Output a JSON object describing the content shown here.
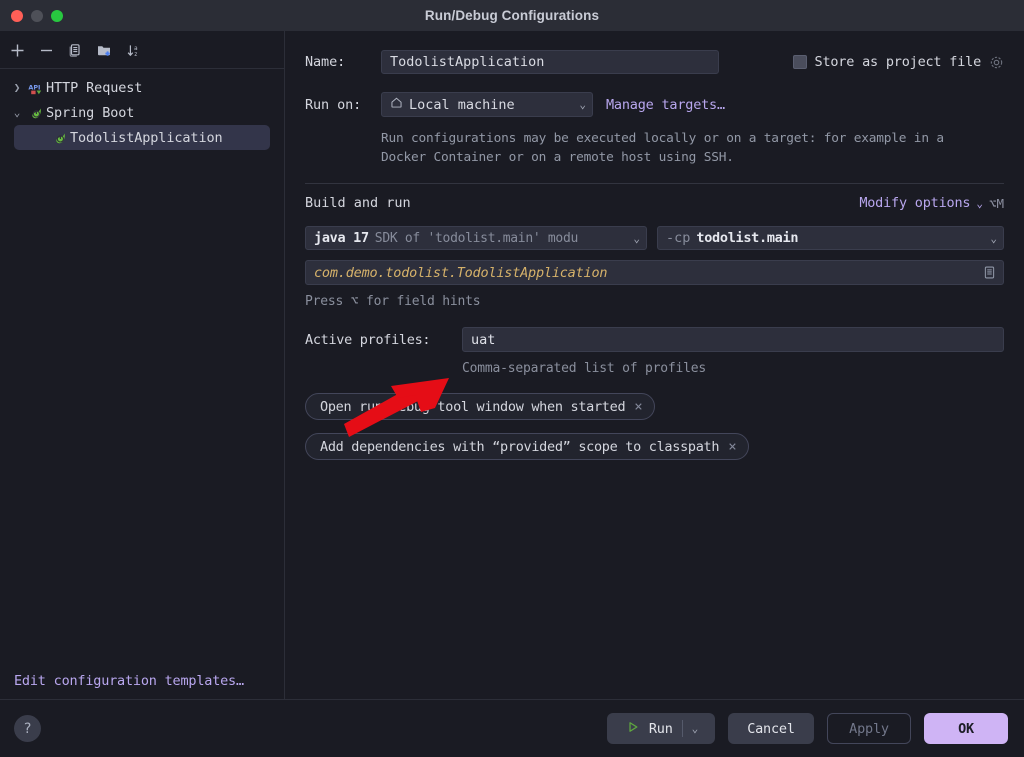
{
  "window": {
    "title": "Run/Debug Configurations",
    "traffic_lights": [
      "close",
      "minimize",
      "zoom"
    ]
  },
  "sidebar": {
    "toolbar": [
      {
        "name": "add-configuration",
        "icon": "plus-icon"
      },
      {
        "name": "remove-configuration",
        "icon": "minus-icon"
      },
      {
        "name": "copy-configuration",
        "icon": "copy-icon"
      },
      {
        "name": "new-folder",
        "icon": "new-folder-icon"
      },
      {
        "name": "sort-configurations",
        "icon": "sort-alpha-icon"
      }
    ],
    "tree": [
      {
        "label": "HTTP Request",
        "icon": "http-request-icon",
        "expanded": false,
        "level": 0,
        "selected": false
      },
      {
        "label": "Spring Boot",
        "icon": "spring-boot-icon",
        "expanded": true,
        "level": 0,
        "selected": false
      },
      {
        "label": "TodolistApplication",
        "icon": "spring-boot-icon",
        "level": 1,
        "selected": true
      }
    ],
    "edit_templates": "Edit configuration templates…"
  },
  "main": {
    "name_label": "Name:",
    "name_value": "TodolistApplication",
    "store_as_project_file": {
      "label": "Store as project file",
      "checked": false,
      "gear_icon": "gear-icon"
    },
    "run_on_label": "Run on:",
    "run_on_value": "Local machine",
    "run_on_icon": "home-icon",
    "manage_targets": "Manage targets…",
    "description": "Run configurations may be executed locally or on a target: for example in a Docker Container or on a remote host using SSH.",
    "section_title": "Build and run",
    "modify_options": {
      "label": "Modify options",
      "shortcut": "⌥M",
      "chevron": "chevron-down-icon"
    },
    "sdk": {
      "version": "java 17",
      "detail": "SDK of 'todolist.main' modu"
    },
    "classpath": {
      "flag": "-cp",
      "value": "todolist.main"
    },
    "main_class": "com.demo.todolist.TodolistApplication",
    "main_class_browse_icon": "list-browse-icon",
    "field_hint": "Press ⌥ for field hints",
    "active_profiles_label": "Active profiles:",
    "active_profiles_value": "uat",
    "active_profiles_hint": "Comma-separated list of profiles",
    "chips": [
      {
        "label": "Open run/debug tool window when started",
        "close": "×"
      },
      {
        "label": "Add dependencies with “provided” scope to classpath",
        "close": "×"
      }
    ]
  },
  "annotation": {
    "arrow_color": "#e50d16",
    "points_at": "active-profiles-input"
  },
  "footer": {
    "help": "?",
    "run_label": "Run",
    "run_icon": "play-icon",
    "run_dropdown_icon": "chevron-down-icon",
    "cancel_label": "Cancel",
    "apply_label": "Apply",
    "apply_enabled": false,
    "ok_label": "OK"
  },
  "colors": {
    "accent_link": "#b9a7ef",
    "ok_button": "#cfb4f5",
    "main_class_text": "#d6b26a",
    "run_play": "#5fa83f",
    "annotation_red": "#e50d16",
    "panel_bg": "#1a1b23",
    "titlebar_bg": "#2b2d36",
    "field_bg": "#2d2f3c"
  }
}
